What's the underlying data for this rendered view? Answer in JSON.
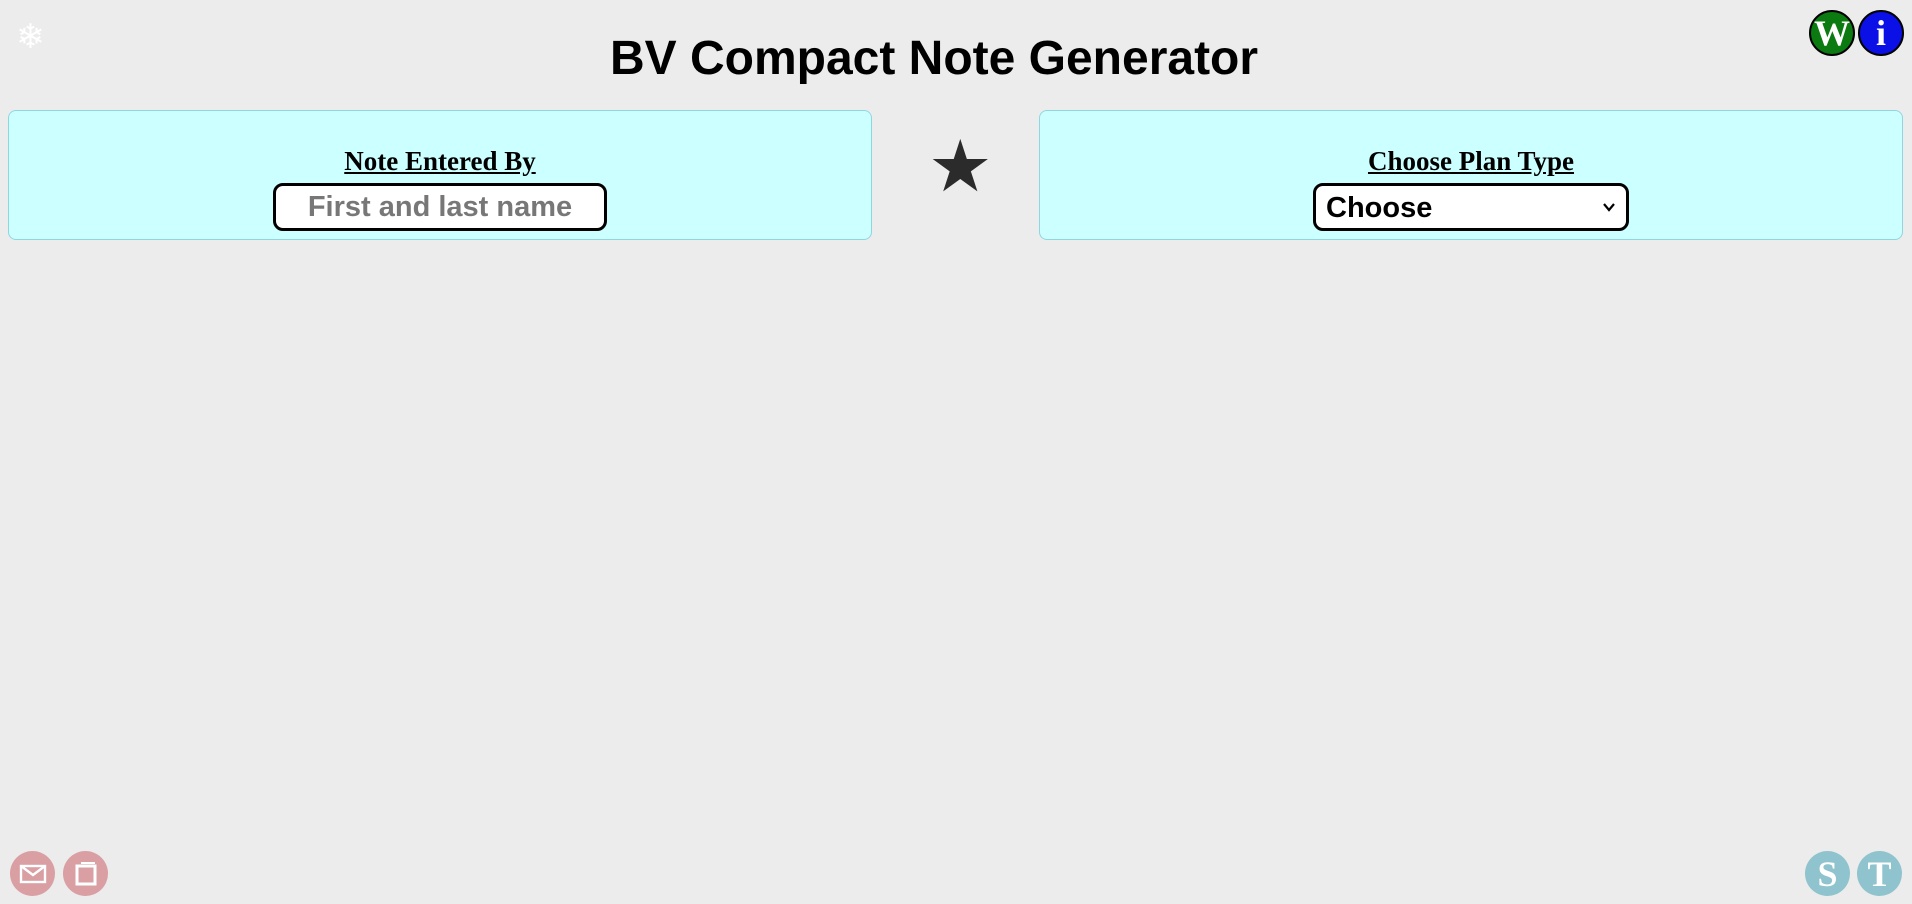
{
  "header": {
    "snow_symbol": "❄",
    "title": "BV Compact Note Generator",
    "w_button_label": "W",
    "i_button_label": "i"
  },
  "note_entered_by": {
    "label": "Note Entered By",
    "placeholder": "First and last name",
    "value": ""
  },
  "favorite": {
    "symbol": "★"
  },
  "plan_type": {
    "label": "Choose Plan Type",
    "selected": "Choose"
  },
  "footer": {
    "s_button_label": "S",
    "t_button_label": "T"
  },
  "colors": {
    "background": "#ececec",
    "panel": "#ccffff",
    "w_button": "#0b7a10",
    "i_button": "#0a10e6",
    "footer_left_buttons": "#d99fa3",
    "footer_right_buttons": "#8fc3cd"
  },
  "icons": {
    "top_left": "snowflake-icon",
    "center": "star-icon",
    "footer_left": [
      "envelope-icon",
      "window-icon"
    ],
    "select": "chevron-down-icon"
  }
}
